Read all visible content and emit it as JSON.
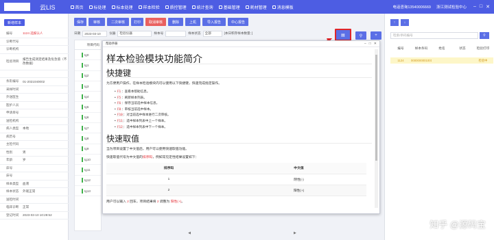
{
  "app": {
    "name": "云LIS"
  },
  "nav": [
    {
      "label": "首页",
      "icon": "home-icon"
    },
    {
      "label": "标处理",
      "icon": "flag-icon"
    },
    {
      "label": "标本处理",
      "icon": "tube-icon"
    },
    {
      "label": "样本检验",
      "icon": "flask-icon"
    },
    {
      "label": "质控管理",
      "icon": "chart-icon"
    },
    {
      "label": "统计查询",
      "icon": "stats-icon"
    },
    {
      "label": "基础管理",
      "icon": "gear-icon"
    },
    {
      "label": "耗材管理",
      "icon": "box-icon"
    },
    {
      "label": "消息模板",
      "icon": "message-icon"
    }
  ],
  "topright": {
    "phone": "电话咨询13540006669",
    "user": "浙江测试检验中心"
  },
  "left": {
    "new_label": "新增样本",
    "rows": [
      {
        "label": "编号",
        "value": "1124  选报认人",
        "red": true
      },
      {
        "label": "诊断代号",
        "value": ""
      },
      {
        "label": "诊断机构",
        "value": ""
      },
      {
        "label": "检验项目",
        "value": "报告生成测定结果及危急值（不改数据）"
      },
      {
        "label": "",
        "value": ""
      },
      {
        "label": "条形编号",
        "value": "01-2021040002"
      },
      {
        "label": "采样时间",
        "value": ""
      },
      {
        "label": "外送医生",
        "value": ""
      },
      {
        "label": "医护人员",
        "value": ""
      },
      {
        "label": "申请单号",
        "value": ""
      },
      {
        "label": "送检机构",
        "value": ""
      },
      {
        "label": "病人类型",
        "value": "本地"
      },
      {
        "label": "病历号",
        "value": ""
      },
      {
        "label": "主检代码",
        "value": ""
      },
      {
        "label": "性别",
        "value": "男"
      },
      {
        "label": "年龄",
        "value": "岁"
      },
      {
        "label": "床号",
        "value": ""
      },
      {
        "label": "床号",
        "value": ""
      },
      {
        "label": "样本类型",
        "value": "血液"
      },
      {
        "label": "样本状态",
        "value": "外观正常"
      },
      {
        "label": "送检时间",
        "value": ""
      },
      {
        "label": "临床诊断",
        "value": "正常"
      },
      {
        "label": "登记时间",
        "value": "2023-03-10 10:28:52"
      }
    ]
  },
  "toolbar": [
    "保存",
    "审核",
    "二次审核",
    "打印",
    "取消审核",
    "删除",
    "上机",
    "导入报告",
    "中心报告"
  ],
  "filter": {
    "date_label": "日期",
    "date_value": "2023-03-10",
    "instrument_label": "仪器",
    "instrument_value": "检验仪器",
    "sample_no_label": "样本号",
    "status_label": "样本状态",
    "status_value": "全部",
    "count_label": "[本日积存样本数量：]"
  },
  "grid": {
    "header": "项目代码",
    "rows": [
      "tg0",
      "tg1",
      "tg2",
      "tg3",
      "tg4",
      "tg5",
      "tg6",
      "tg7",
      "tg8",
      "tg9",
      "tg10",
      "tg11",
      "tg12",
      "tg13"
    ]
  },
  "modal": {
    "title": "帮助手册",
    "h1": "样本检验模块功能简介",
    "h2_shortcut": "快捷键",
    "shortcut_intro": "为方便用户操作，在样本检验模块内可以使用以下快捷键，快速完成指定操作。",
    "shortcuts": [
      {
        "key": "F1",
        "desc": "：查看本帮助信息。"
      },
      {
        "key": "F5",
        "desc": "：刷新样本列表。"
      },
      {
        "key": "F6",
        "desc": "：保存当前选中样本信息。"
      },
      {
        "key": "F8",
        "desc": "：审核当前选中样本。"
      },
      {
        "key": "F10",
        "desc": "：对当前选中样本进行二次审核。"
      },
      {
        "key": "F11",
        "desc": "：选中样本列表中上一个样本。"
      },
      {
        "key": "F12",
        "desc": "：选中样本列表中下一个样本。"
      }
    ],
    "h2_quick": "快速取值",
    "quick_intro": "当为项目设置了中文值后，用户可以使用快速取值功能。",
    "quick_desc_pre": "快速取值代号为中文值的",
    "quick_code": "排序码",
    "quick_desc_post": "，例如常见定性结果设置如下：",
    "table_headers": [
      "排序码",
      "中文值"
    ],
    "table_rows": [
      [
        "1",
        "阴性(-)"
      ],
      [
        "2",
        "阳性(+)"
      ]
    ],
    "footer_pre": "用户可以输入",
    "footer_key": "2",
    "footer_mid": "回车，项目结果将",
    "footer_key2": "2",
    "footer_mid2": "调整为",
    "footer_val": "阳性(+)",
    "footer_end": "。"
  },
  "right": {
    "search_placeholder": "检索/条码编号",
    "headers": [
      "编号",
      "样本条码",
      "姓名",
      "状态",
      "检验打印"
    ],
    "row": [
      "1124",
      "0000000001001",
      "",
      "",
      "检验中"
    ]
  },
  "watermark": "知乎 @源码宝"
}
